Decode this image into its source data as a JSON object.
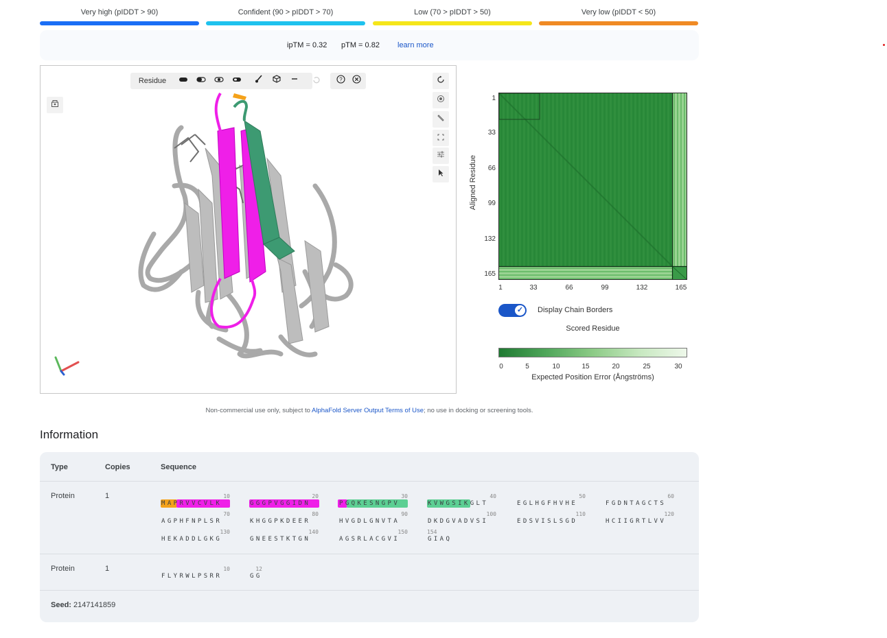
{
  "legend": [
    {
      "label": "Very high (pIDDT > 90)",
      "color": "#1a6ef5"
    },
    {
      "label": "Confident (90 > pIDDT > 70)",
      "color": "#1fc2ee"
    },
    {
      "label": "Low (70 > pIDDT > 50)",
      "color": "#f5e61a"
    },
    {
      "label": "Very low (pIDDT < 50)",
      "color": "#f08a24"
    }
  ],
  "metrics": {
    "iptm": "ipTM = 0.32",
    "ptm": "pTM = 0.82",
    "learn_more": "learn more"
  },
  "viewer": {
    "toolbar_label": "Residue",
    "toolbar_icons": [
      "cartoon-icon",
      "ball-stick-icon",
      "surface-icon",
      "spacefill-icon",
      "brush-icon",
      "cube-icon",
      "minus-icon",
      "undo-icon",
      "help-icon",
      "close-icon"
    ],
    "right_tools": [
      "rotate-icon",
      "camera-icon",
      "wrench-icon",
      "fullscreen-icon",
      "sliders-icon",
      "pointer-icon"
    ]
  },
  "pae": {
    "y_label": "Aligned Residue",
    "y_ticks": [
      "1",
      "33",
      "66",
      "99",
      "132",
      "165"
    ],
    "x_ticks": [
      "1",
      "33",
      "66",
      "99",
      "132",
      "165"
    ],
    "toggle_label": "Display Chain Borders",
    "scored_label": "Scored Residue",
    "colorbar_ticks": [
      "0",
      "5",
      "10",
      "15",
      "20",
      "25",
      "30"
    ],
    "colorbar_label": "Expected Position Error (Ångströms)"
  },
  "footer": {
    "pre": "Non-commercial use only, subject to ",
    "link": "AlphaFold Server Output Terms of Use",
    "post": "; no use in docking or screening tools."
  },
  "info": {
    "title": "Information",
    "headers": {
      "type": "Type",
      "copies": "Copies",
      "sequence": "Sequence"
    },
    "row1": {
      "type": "Protein",
      "copies": "1"
    },
    "row2": {
      "type": "Protein",
      "copies": "1"
    },
    "seed_label": "Seed:",
    "seed_value": "2147141859"
  },
  "sequence1": {
    "line1": [
      "MAPRVVCVLK",
      "GGGPVGGIDN",
      "PGQKESNGPV",
      "KVWGSIKGLT",
      "EGLHGFHVHE",
      "FGDNTAGCTS"
    ],
    "line1_nums": [
      "10",
      "20",
      "30",
      "40",
      "50",
      "60"
    ],
    "line2": [
      "AGPHFNPLSR",
      "KHGGPKDEER",
      "HVGDLGNVTA",
      "DKDGVADVSI",
      "EDSVISLSGD",
      "HCIIGRTLVV"
    ],
    "line2_nums": [
      "70",
      "80",
      "90",
      "100",
      "110",
      "120"
    ],
    "line3": [
      "HEKADDLGKG",
      "GNEESTKTGN",
      "AGSRLACGVI",
      "GIAQ"
    ],
    "line3_nums": [
      "130",
      "140",
      "150",
      "154"
    ]
  },
  "sequence2": {
    "line1": [
      "FLYRWLPSRR",
      "GG"
    ],
    "line1_nums": [
      "10",
      "12"
    ]
  },
  "colors": {
    "orange": "#f5a21a",
    "magenta": "#f020e0",
    "green": "#5ccf93",
    "link": "#1a56c8"
  }
}
